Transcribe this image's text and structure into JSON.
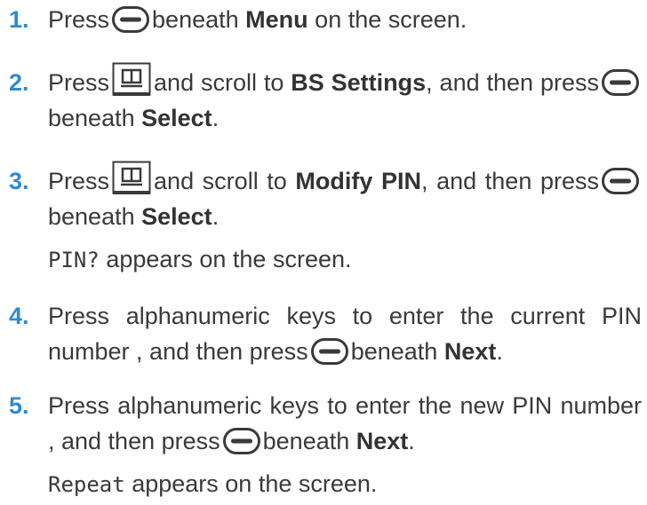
{
  "icons": {
    "softkey": "softkey-button-icon",
    "phonebook": "phonebook-key-icon"
  },
  "colors": {
    "step_number": "#2f8ad0",
    "text": "#3a3a3a"
  },
  "steps": [
    {
      "number": "1.",
      "press": "Press",
      "beneath": "beneath",
      "menu": "Menu",
      "tail": "on the screen."
    },
    {
      "number": "2.",
      "press": "Press",
      "scroll": "and scroll to",
      "target": "BS Settings",
      "and_then": ", and then",
      "press_lc": "press",
      "beneath": "beneath",
      "select": "Select",
      "period": "."
    },
    {
      "number": "3.",
      "press": "Press",
      "scroll": "and scroll to",
      "target": "Modify PIN",
      "and_then": ", and then",
      "press_lc": "press",
      "beneath": "beneath",
      "select": "Select",
      "period": "."
    },
    {
      "note_mono": "PIN?",
      "note_text": "appears on the screen."
    },
    {
      "number": "4.",
      "text1": "Press alphanumeric keys to enter the current PIN number , and then press",
      "beneath": "beneath",
      "next": "Next",
      "period": "."
    },
    {
      "number": "5.",
      "text1": "Press alphanumeric keys to enter the new PIN number , and then press",
      "beneath": "beneath",
      "next": "Next",
      "period": "."
    },
    {
      "note_mono": "Repeat",
      "note_text": "appears on the screen."
    }
  ]
}
